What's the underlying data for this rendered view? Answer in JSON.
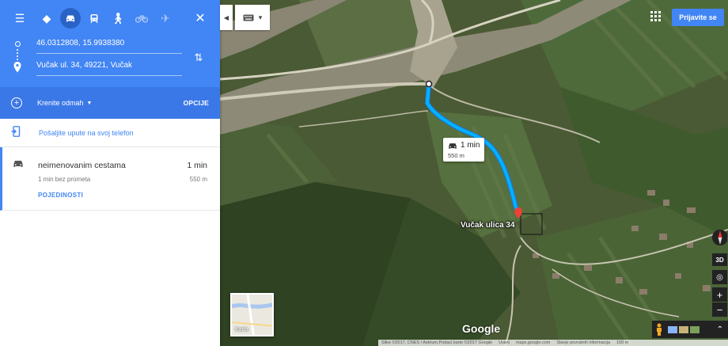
{
  "panel": {
    "origin": "46.0312808, 15.9938380",
    "destination": "Vučak ul. 34, 49221, Vučak",
    "leave_label": "Krenite odmah",
    "options_label": "OPCIJE",
    "send_label": "Pošaljite upute na svoj telefon",
    "route": {
      "name": "neimenovanim cestama",
      "time": "1 min",
      "sub": "1 min bez prometa",
      "distance": "550 m",
      "details": "POJEDINOSTI"
    },
    "modes": [
      "directions-icon",
      "car-icon",
      "transit-icon",
      "walk-icon",
      "bike-icon",
      "flight-icon"
    ],
    "active_mode": "car-icon"
  },
  "map": {
    "signin": "Prijavite se",
    "tooltip_time": "1 min",
    "tooltip_dist": "550 m",
    "destination_label": "Vučak ulica 34",
    "karta_label": "Karta",
    "google": "Google",
    "control_3d": "3D",
    "footer": [
      "Slike ©2017, CNES / Astrium,Podaci karte ©2017 Google",
      "Uvjeti",
      "maps.google.com",
      "Slanje povratnih informacija",
      "100 m"
    ]
  },
  "colors": {
    "accent": "#4285f4",
    "route": "#00b3fd",
    "pin": "#ea4335"
  }
}
